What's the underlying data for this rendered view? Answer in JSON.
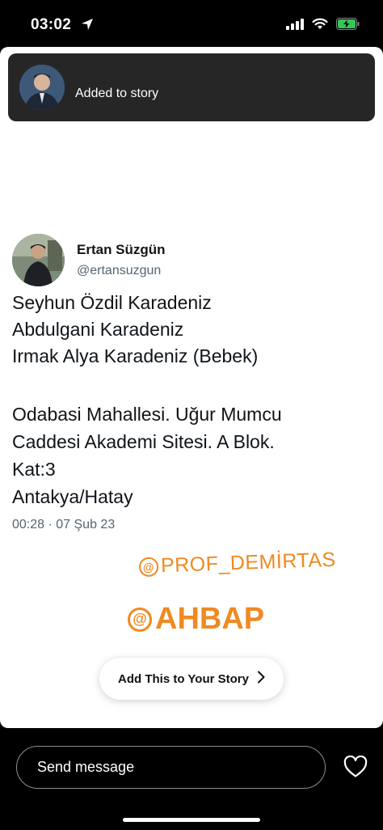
{
  "status_bar": {
    "time": "03:02",
    "icons": [
      "location-arrow-icon",
      "signal-icon",
      "wifi-icon",
      "battery-charging-icon"
    ],
    "battery_color": "#34c759"
  },
  "toast": {
    "text": "Added to story"
  },
  "tweet": {
    "author_name": "Ertan Süzgün",
    "author_handle": "@ertansuzgun",
    "lines": [
      "Seyhun Özdil Karadeniz",
      "Abdulgani Karadeniz",
      "Irmak Alya Karadeniz (Bebek)",
      "Odabasi Mahallesi. Uğur Mumcu",
      "Caddesi Akademi Sitesi. A Blok.",
      "Kat:3",
      "Antakya/Hatay"
    ],
    "timestamp": "00:28 · 07 Şub 23"
  },
  "stickers": {
    "mention_1": "PROF_DEMİRTAS",
    "mention_2": "AHBAP",
    "color": "#ef8a22"
  },
  "add_to_story": {
    "label": "Add This to Your Story"
  },
  "reply_bar": {
    "placeholder": "Send message"
  }
}
